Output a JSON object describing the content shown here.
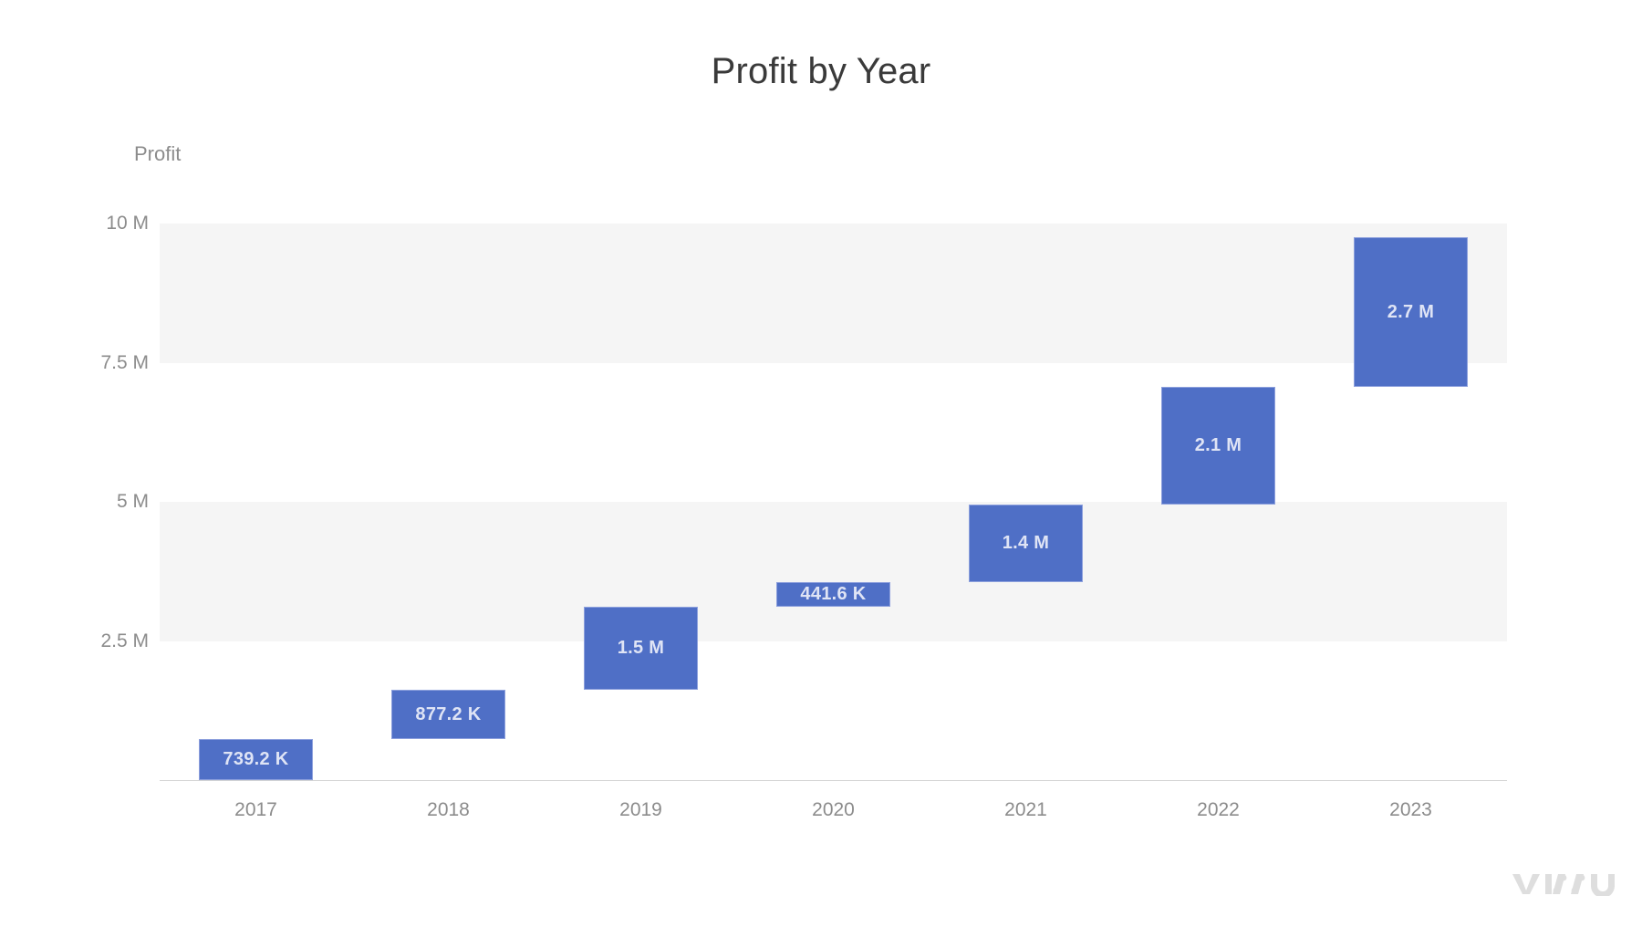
{
  "chart_data": {
    "type": "bar",
    "subtype": "waterfall",
    "title": "Profit by Year",
    "xlabel": "",
    "ylabel": "Profit",
    "categories": [
      "2017",
      "2018",
      "2019",
      "2020",
      "2021",
      "2022",
      "2023"
    ],
    "values": [
      739200,
      877200,
      1500000,
      441600,
      1400000,
      2100000,
      2700000
    ],
    "value_labels": [
      "739.2 K",
      "877.2 K",
      "1.5 M",
      "441.6 K",
      "1.4 M",
      "2.1 M",
      "2.7 M"
    ],
    "bar_starts": [
      0,
      739200,
      1616400,
      3116400,
      3558000,
      4958000,
      7058000
    ],
    "bar_ends": [
      739200,
      1616400,
      3116400,
      3558000,
      4958000,
      7058000,
      9758000
    ],
    "ylim": [
      0,
      10500000
    ],
    "ytick_values": [
      10000000,
      7500000,
      5000000,
      2500000
    ],
    "ytick_labels": [
      "10 M",
      "7.5 M",
      "5 M",
      "2.5 M"
    ],
    "grid": false,
    "alternating_bands": true,
    "band_ranges": [
      [
        7500000,
        10000000
      ],
      [
        2500000,
        5000000
      ]
    ],
    "legend": "none",
    "bar_color": "#4f6fc6",
    "bar_border_color": "#8da0dd",
    "band_color": "#f5f5f5",
    "label_color": "#dfe4f5",
    "axis_text_color": "#8c8c8c",
    "title_color": "#3a3a3a",
    "background": "#ffffff"
  },
  "watermark": {
    "text": "VIZZU"
  }
}
